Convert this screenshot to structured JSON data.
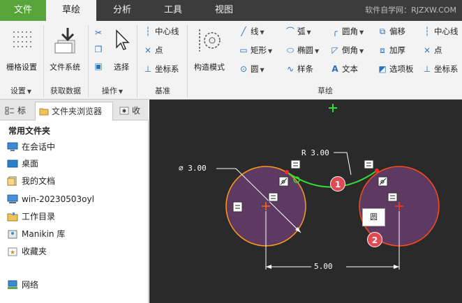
{
  "menubar": {
    "tabs": [
      "文件",
      "草绘",
      "分析",
      "工具",
      "视图"
    ],
    "active_tab": "草绘",
    "watermark": "软件自学网：RJZXW.COM"
  },
  "ribbon": {
    "settings": {
      "grid_settings": "栅格设置",
      "group": "设置"
    },
    "get_data": {
      "file_system": "文件系统",
      "group": "获取数据"
    },
    "operations": {
      "select": "选择",
      "group": "操作"
    },
    "datum": {
      "centerline": "中心线",
      "point": "点",
      "coordsys": "坐标系",
      "group": "基准"
    },
    "sketch": {
      "construction_mode": "构造模式",
      "line": "线",
      "rectangle": "矩形",
      "circle": "圆",
      "arc": "弧",
      "ellipse": "椭圆",
      "spline": "样条",
      "fillet": "圆角",
      "chamfer": "倒角",
      "text": "文本",
      "offset": "偏移",
      "thicken": "加厚",
      "palette": "选项板",
      "centerline": "中心线",
      "point": "点",
      "coordsys": "坐标系",
      "group": "草绘"
    }
  },
  "panel": {
    "tabs": {
      "model_tree_short": "标",
      "folder_browser": "文件夹浏览器",
      "favorites_short": "收"
    },
    "header": "常用文件夹",
    "items": [
      "在会话中",
      "桌面",
      "我的文档",
      "win-20230503oyl",
      "工作目录",
      "Manikin 库",
      "收藏夹"
    ],
    "network": "网络"
  },
  "canvas": {
    "dims": {
      "diameter": "⌀ 3.00",
      "radius": "R 3.00",
      "distance": "5.00"
    },
    "badges": [
      "1",
      "2"
    ],
    "tooltip": "圆",
    "colors": {
      "background": "#2a2a2a",
      "circle_fill": "#5e3a62",
      "circle_stroke": "#ff9a1a",
      "arc": "#33dd33",
      "dimension": "#ffffff",
      "badge": "#e04a52"
    }
  }
}
